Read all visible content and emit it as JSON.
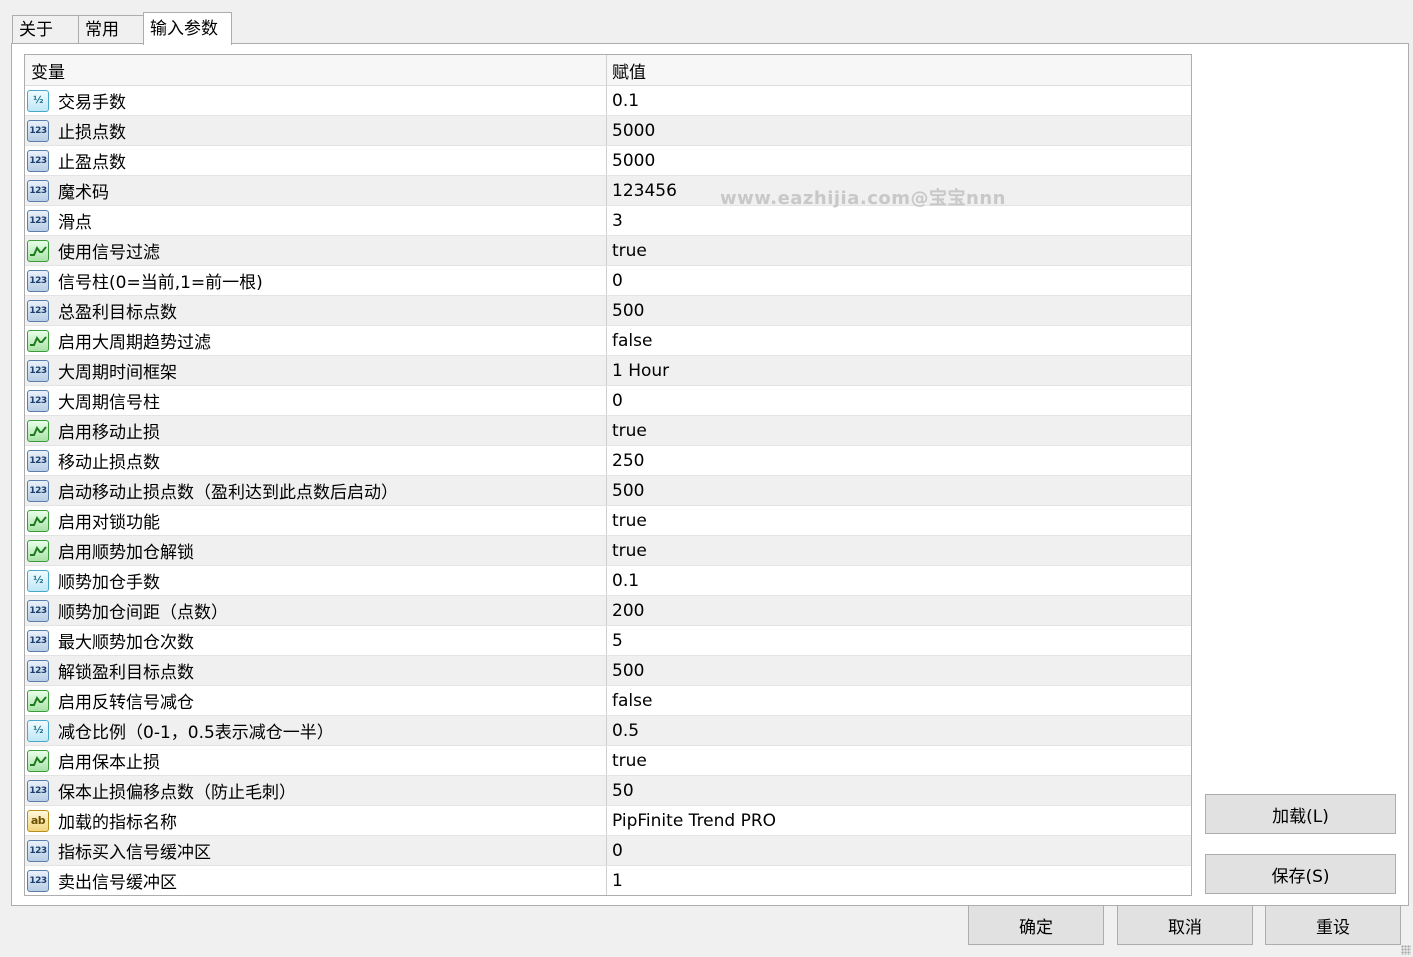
{
  "tabs": [
    {
      "label": "关于"
    },
    {
      "label": "常用"
    },
    {
      "label": "输入参数"
    }
  ],
  "table": {
    "headers": {
      "name": "变量",
      "value": "赋值"
    },
    "rows": [
      {
        "icon": "double",
        "name": "交易手数",
        "value": "0.1"
      },
      {
        "icon": "int",
        "name": "止损点数",
        "value": "5000"
      },
      {
        "icon": "int",
        "name": "止盈点数",
        "value": "5000"
      },
      {
        "icon": "int",
        "name": "魔术码",
        "value": "123456"
      },
      {
        "icon": "int",
        "name": "滑点",
        "value": "3"
      },
      {
        "icon": "bool",
        "name": "使用信号过滤",
        "value": "true"
      },
      {
        "icon": "int",
        "name": "信号柱(0=当前,1=前一根)",
        "value": "0"
      },
      {
        "icon": "int",
        "name": "总盈利目标点数",
        "value": "500"
      },
      {
        "icon": "bool",
        "name": "启用大周期趋势过滤",
        "value": "false"
      },
      {
        "icon": "int",
        "name": "大周期时间框架",
        "value": "1 Hour"
      },
      {
        "icon": "int",
        "name": "大周期信号柱",
        "value": "0"
      },
      {
        "icon": "bool",
        "name": "启用移动止损",
        "value": "true"
      },
      {
        "icon": "int",
        "name": "移动止损点数",
        "value": "250"
      },
      {
        "icon": "int",
        "name": "启动移动止损点数（盈利达到此点数后启动）",
        "value": "500"
      },
      {
        "icon": "bool",
        "name": "启用对锁功能",
        "value": "true"
      },
      {
        "icon": "bool",
        "name": "启用顺势加仓解锁",
        "value": "true"
      },
      {
        "icon": "double",
        "name": "顺势加仓手数",
        "value": "0.1"
      },
      {
        "icon": "int",
        "name": "顺势加仓间距（点数）",
        "value": "200"
      },
      {
        "icon": "int",
        "name": "最大顺势加仓次数",
        "value": "5"
      },
      {
        "icon": "int",
        "name": "解锁盈利目标点数",
        "value": "500"
      },
      {
        "icon": "bool",
        "name": "启用反转信号减仓",
        "value": "false"
      },
      {
        "icon": "double",
        "name": "减仓比例（0-1，0.5表示减仓一半）",
        "value": "0.5"
      },
      {
        "icon": "bool",
        "name": "启用保本止损",
        "value": "true"
      },
      {
        "icon": "int",
        "name": "保本止损偏移点数（防止毛刺）",
        "value": "50"
      },
      {
        "icon": "string",
        "name": "加载的指标名称",
        "value": "PipFinite Trend PRO"
      },
      {
        "icon": "int",
        "name": "指标买入信号缓冲区",
        "value": "0"
      },
      {
        "icon": "int",
        "name": "卖出信号缓冲区",
        "value": "1"
      }
    ]
  },
  "watermark": "www.eazhijia.com@宝宝nnn",
  "buttons": {
    "load": "加载(L)",
    "save": "保存(S)",
    "ok": "确定",
    "cancel": "取消",
    "reset": "重设"
  },
  "icon_labels": {
    "int": "123",
    "double": "½",
    "string": "ab"
  }
}
